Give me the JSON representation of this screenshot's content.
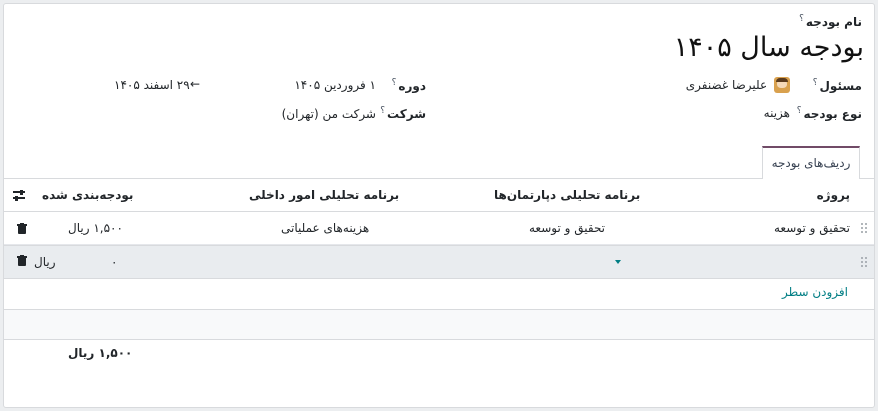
{
  "form": {
    "name_label": "نام بودجه",
    "name_help": "؟",
    "title": "بودجه سال ۱۴۰۵",
    "responsible_label": "مسئول",
    "responsible_value": "علیرضا غضنفری",
    "budget_type_label": "نوع بودجه",
    "budget_type_value": "هزینه",
    "period_label": "دوره",
    "period_start": "۱ فروردین ۱۴۰۵",
    "period_arrow": "←",
    "period_end": "۲۹ اسفند ۱۴۰۵",
    "company_label": "شرکت",
    "company_value": "شرکت من (تهران)",
    "help_mark": "؟"
  },
  "tabs": [
    {
      "label": "ردیف‌های بودجه"
    }
  ],
  "table": {
    "headers": {
      "project": "پروژه",
      "dept_plan": "برنامه تحلیلی دپارتمان‌ها",
      "internal_plan": "برنامه تحلیلی امور داخلی",
      "budgeted": "بودجه‌بندی شده"
    },
    "rows": [
      {
        "project": "تحقیق و توسعه",
        "dept_plan": "تحقیق و توسعه",
        "internal_plan": "هزینه‌های عملیاتی",
        "budgeted": "۱,۵۰۰ ریال"
      },
      {
        "project": "",
        "dept_plan": "",
        "internal_plan": "",
        "budgeted_amount": "۰",
        "budgeted_currency": "ریال"
      }
    ],
    "add_line": "افزودن سطر",
    "total": "۱,۵۰۰ ریال"
  },
  "colors": {
    "accent": "#714b67",
    "link": "#017e84"
  }
}
